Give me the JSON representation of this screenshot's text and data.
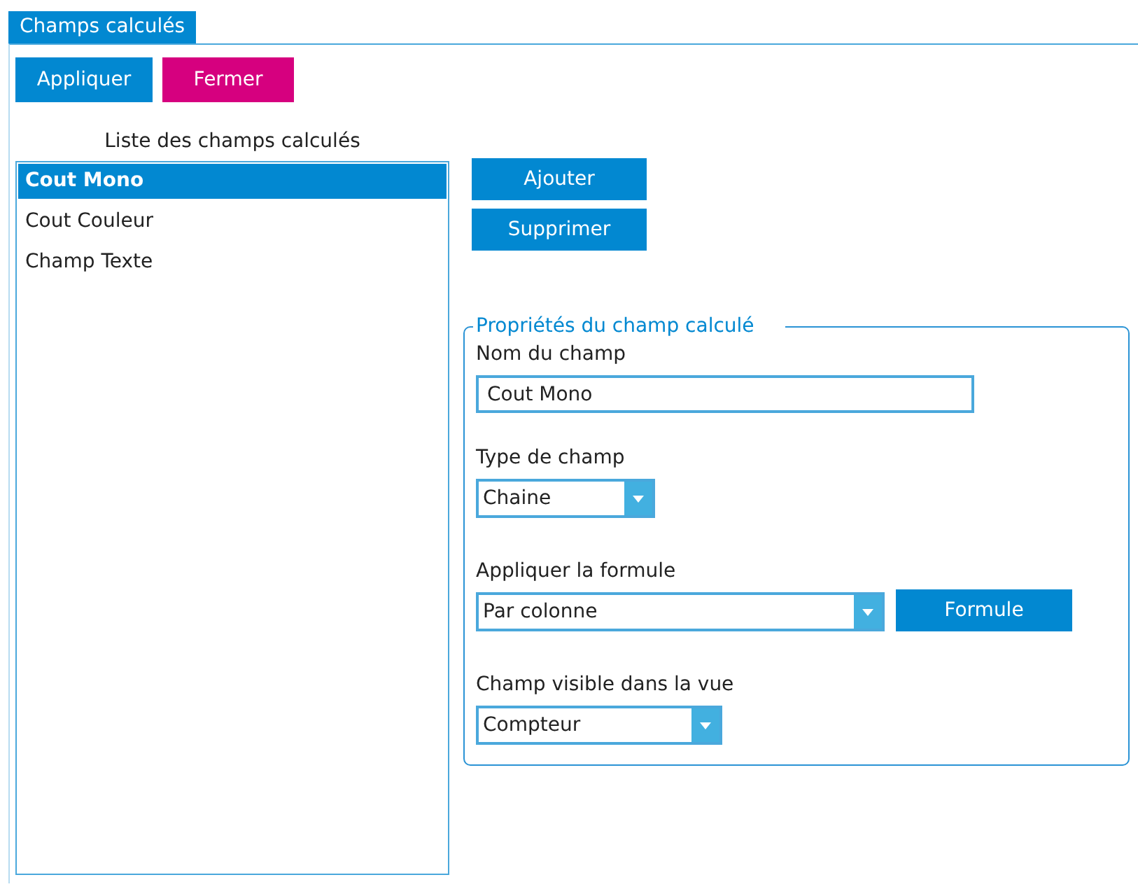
{
  "tab": {
    "label": "Champs calculés",
    "selected": true
  },
  "actions": [
    {
      "label": "Appliquer",
      "kind": "primary"
    },
    {
      "label": "Fermer",
      "kind": "danger"
    }
  ],
  "list": {
    "caption": "Liste des champs calculés",
    "items": [
      {
        "label": "Cout Mono",
        "selected": true
      },
      {
        "label": "Cout Couleur",
        "selected": false
      },
      {
        "label": "Champ Texte",
        "selected": false
      }
    ]
  },
  "list_buttons": [
    "Ajouter",
    "Supprimer"
  ],
  "properties": {
    "legend": "Propriétés du champ calculé",
    "fields": [
      {
        "label": "Nom du champ",
        "kind": "text",
        "value": "Cout Mono"
      },
      {
        "label": "Type de champ",
        "kind": "select",
        "value": "Chaine"
      },
      {
        "label": "Appliquer la formule",
        "kind": "select",
        "value": "Par colonne",
        "button": "Formule"
      },
      {
        "label": "Champ visible dans la vue",
        "kind": "select",
        "value": "Compteur"
      }
    ]
  }
}
